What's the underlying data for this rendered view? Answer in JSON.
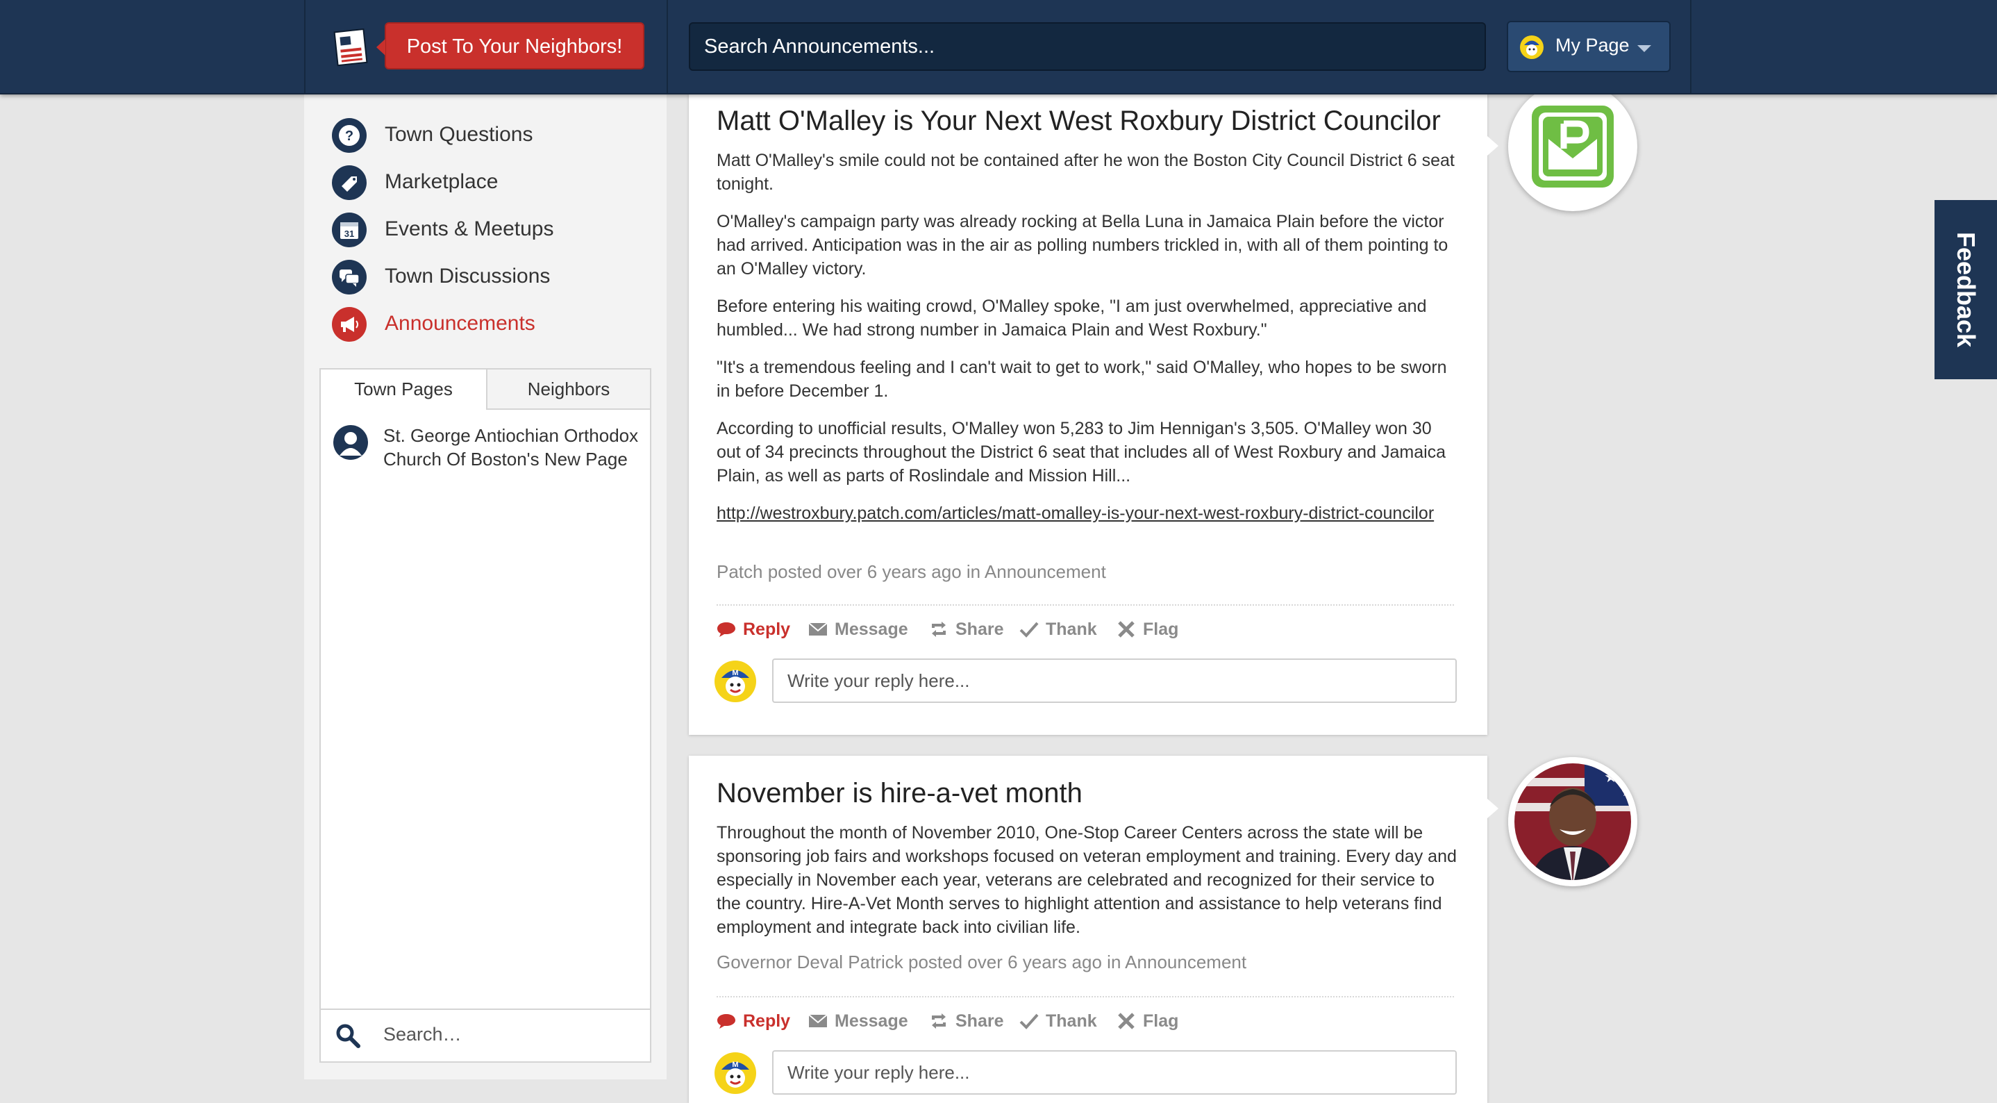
{
  "header": {
    "post_button": "Post To Your Neighbors!",
    "search_placeholder": "Search Announcements...",
    "my_page": "My Page"
  },
  "sidebar": {
    "nav": [
      {
        "label": "Town Questions",
        "icon": "question-icon"
      },
      {
        "label": "Marketplace",
        "icon": "tag-icon"
      },
      {
        "label": "Events & Meetups",
        "icon": "calendar-icon"
      },
      {
        "label": "Town Discussions",
        "icon": "chat-bubbles-icon"
      },
      {
        "label": "Announcements",
        "icon": "megaphone-icon",
        "active": true
      }
    ],
    "calendar_day": "31",
    "tabs": [
      "Town Pages",
      "Neighbors"
    ],
    "pages": [
      {
        "name": "St. George Antiochian Orthodox Church Of Boston's New Page"
      }
    ],
    "search_placeholder": "Search…"
  },
  "posts": [
    {
      "title": "Matt O'Malley is Your Next West Roxbury District Councilor",
      "paragraphs": [
        "Matt O'Malley's smile could not be contained after he won the Boston City Council District 6 seat tonight.",
        "O'Malley's campaign party was already rocking at Bella Luna in Jamaica Plain before the victor had arrived. Anticipation was in the air as polling numbers trickled in, with all of them pointing to an O'Malley victory.",
        "Before entering his waiting crowd, O'Malley spoke, \"I am just overwhelmed, appreciative and humbled... We had strong number in Jamaica Plain and West Roxbury.\"",
        "\"It's a tremendous feeling and I can't wait to get to work,\" said O'Malley, who hopes to be sworn in before December 1.",
        "According to unofficial results, O'Malley won 5,283 to Jim Hennigan's 3,505. O'Malley won 30 out of 34 precincts throughout the District 6 seat that includes all of West Roxbury and Jamaica Plain, as well as parts of Roslindale and Mission Hill..."
      ],
      "link": "http://westroxbury.patch.com/articles/matt-omalley-is-your-next-west-roxbury-district-councilor",
      "meta": "Patch posted over 6 years ago in Announcement",
      "author_badge": "patch-logo"
    },
    {
      "title": "November is hire-a-vet month",
      "paragraphs": [
        "Throughout the month of November 2010, One-Stop Career Centers across the state will be sponsoring job fairs and workshops focused on veteran employment and training. Every day and especially in November each year, veterans are celebrated and recognized for their service to the country. Hire-A-Vet Month serves to highlight attention and assistance to help veterans find employment and integrate back into civilian life."
      ],
      "meta": "Governor Deval Patrick posted over 6 years ago in Announcement",
      "author_badge": "governor-photo"
    }
  ],
  "actions": {
    "reply": "Reply",
    "message": "Message",
    "share": "Share",
    "thank": "Thank",
    "flag": "Flag"
  },
  "reply_placeholder": "Write your reply here...",
  "feedback_label": "Feedback",
  "colors": {
    "navy": "#1e3554",
    "accent_red": "#c9302c",
    "patch_green": "#6fbe44",
    "background": "#e6e6e6"
  }
}
